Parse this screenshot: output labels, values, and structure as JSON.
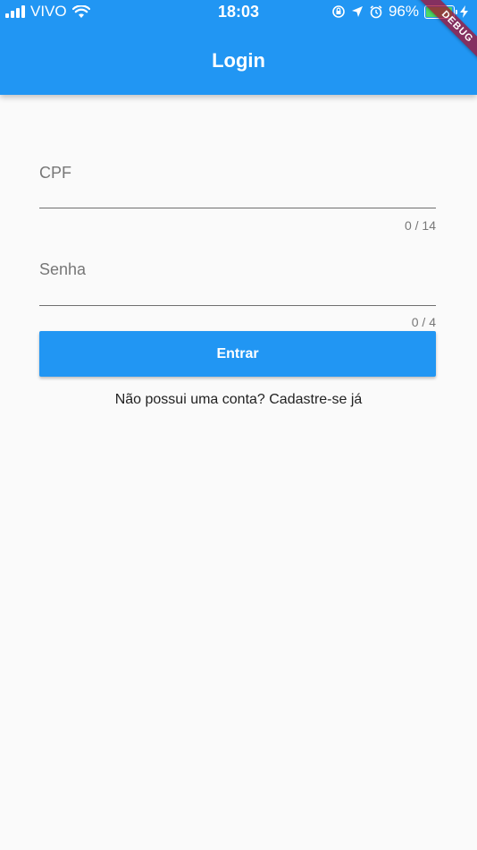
{
  "status_bar": {
    "carrier": "VIVO",
    "time": "18:03",
    "battery_percent": "96%",
    "battery_level": 0.96
  },
  "appbar": {
    "title": "Login"
  },
  "debug_banner": {
    "label": "DEBUG"
  },
  "form": {
    "cpf": {
      "label": "CPF",
      "value": "",
      "counter": "0 / 14"
    },
    "password": {
      "label": "Senha",
      "value": "",
      "counter": "0 / 4"
    },
    "submit_label": "Entrar",
    "signup_text": "Não possui uma conta? Cadastre-se já"
  },
  "colors": {
    "primary": "#2196f3",
    "background": "#fafafa",
    "debug_ribbon": "#a50d2f",
    "battery": "#4cd964"
  },
  "icons": {
    "status_left": [
      "signal-icon",
      "wifi-icon"
    ],
    "status_right": [
      "orientation-lock-icon",
      "location-icon",
      "alarm-icon",
      "battery-icon",
      "charging-icon"
    ]
  }
}
